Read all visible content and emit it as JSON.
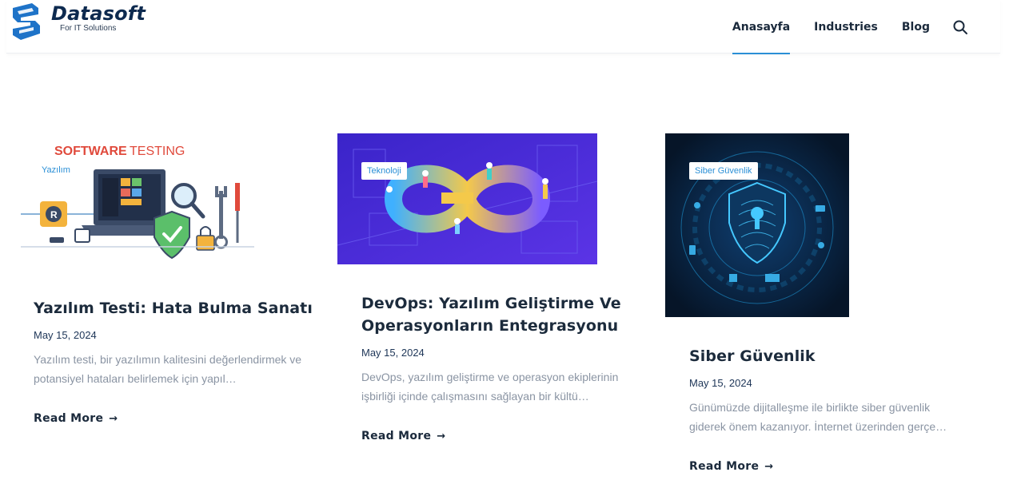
{
  "brand": {
    "name": "Datasoft",
    "tagline": "For IT Solutions"
  },
  "nav": {
    "items": [
      "Anasayfa",
      "Industries",
      "Blog"
    ],
    "active": "Anasayfa",
    "search_icon": "search-icon"
  },
  "colors": {
    "accent": "#2a8fd6",
    "brand_dark": "#0d2a4f",
    "text_muted": "#8a94a3"
  },
  "posts": [
    {
      "category": "Yazılım",
      "image_heading_1": "SOFTWARE",
      "image_heading_2": "TESTING",
      "title": "Yazılım Testi: Hata Bulma Sanatı",
      "date": "May 15, 2024",
      "excerpt": "Yazılım testi, bir yazılımın kalitesini değerlendirmek ve potansiyel hataları belirlemek için yapıl…",
      "read_more": "Read More"
    },
    {
      "category": "Teknoloji",
      "title": "DevOps: Yazılım Geliştirme Ve Operasyonların Entegrasyonu",
      "date": "May 15, 2024",
      "excerpt": "DevOps, yazılım geliştirme ve operasyon ekiplerinin işbirliği içinde çalışmasını sağlayan bir kültü…",
      "read_more": "Read More"
    },
    {
      "category": "Siber Güvenlik",
      "title": "Siber Güvenlik",
      "date": "May 15, 2024",
      "excerpt": "Günümüzde dijitalleşme ile birlikte siber güvenlik giderek önem kazanıyor. İnternet üzerinden gerçe…",
      "read_more": "Read More"
    }
  ]
}
